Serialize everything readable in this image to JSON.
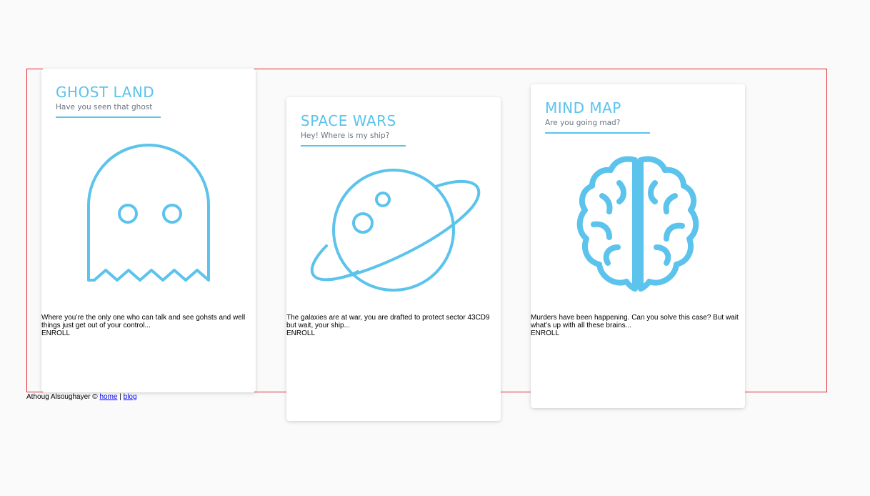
{
  "cards": [
    {
      "title": "GHOST LAND",
      "subtitle": "Have you seen that ghost",
      "icon": "ghost-icon",
      "description": "Where you’re the only one who can talk and see gohsts and well things just get out of your control...",
      "action": "ENROLL"
    },
    {
      "title": "SPACE WARS",
      "subtitle": "Hey! Where is my ship?",
      "icon": "planet-icon",
      "description": "The galaxies are at war, you are drafted to protect sector 43CD9 but wait, your ship...",
      "action": "ENROLL"
    },
    {
      "title": "MIND MAP",
      "subtitle": "Are you going mad?",
      "icon": "brain-icon",
      "description": "Murders have been happening. Can you solve this case? But wait what’s up with all these brains...",
      "action": "ENROLL"
    }
  ],
  "footer": {
    "author": "Athoug Alsoughayer ©",
    "home_link": "home",
    "separator": "|",
    "blog_link": "blog"
  },
  "colors": {
    "accent": "#5bc3ec",
    "frame_border": "#e0252e",
    "background": "#fafafa"
  }
}
